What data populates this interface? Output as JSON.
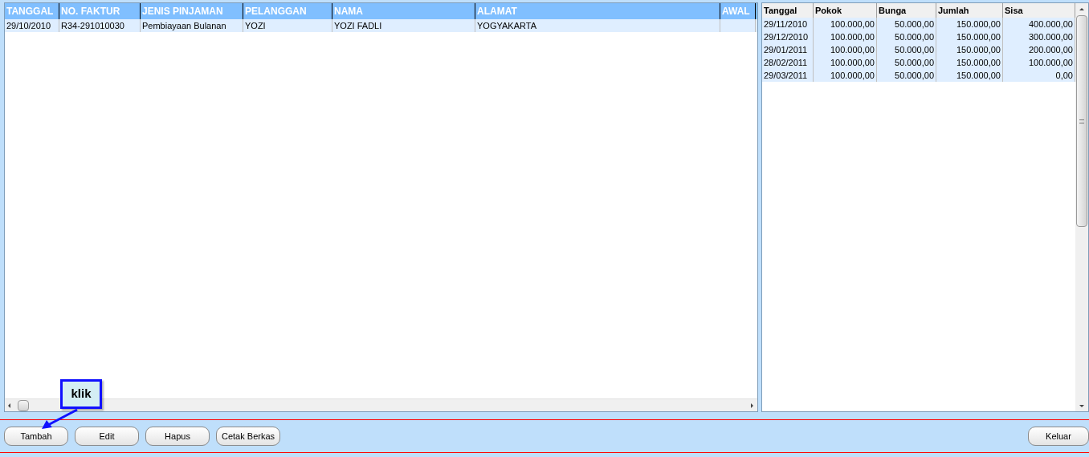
{
  "loans": {
    "columns": [
      "TANGGAL",
      "NO. FAKTUR",
      "JENIS PINJAMAN",
      "PELANGGAN",
      "NAMA",
      "ALAMAT",
      "AWAL"
    ],
    "rows": [
      [
        "29/10/2010",
        "R34-291010030",
        "Pembiayaan Bulanan",
        "YOZI",
        "YOZI FADLI",
        "YOGYAKARTA",
        ""
      ]
    ]
  },
  "installments": {
    "columns": [
      "Tanggal",
      "Pokok",
      "Bunga",
      "Jumlah",
      "Sisa"
    ],
    "rows": [
      [
        "29/11/2010",
        "100.000,00",
        "50.000,00",
        "150.000,00",
        "400.000,00"
      ],
      [
        "29/12/2010",
        "100.000,00",
        "50.000,00",
        "150.000,00",
        "300.000,00"
      ],
      [
        "29/01/2011",
        "100.000,00",
        "50.000,00",
        "150.000,00",
        "200.000,00"
      ],
      [
        "28/02/2011",
        "100.000,00",
        "50.000,00",
        "150.000,00",
        "100.000,00"
      ],
      [
        "29/03/2011",
        "100.000,00",
        "50.000,00",
        "150.000,00",
        "0,00"
      ]
    ]
  },
  "buttons": [
    "Tambah",
    "Edit",
    "Hapus",
    "Cetak Berkas"
  ],
  "exit_button": "Keluar",
  "callout": "klik"
}
